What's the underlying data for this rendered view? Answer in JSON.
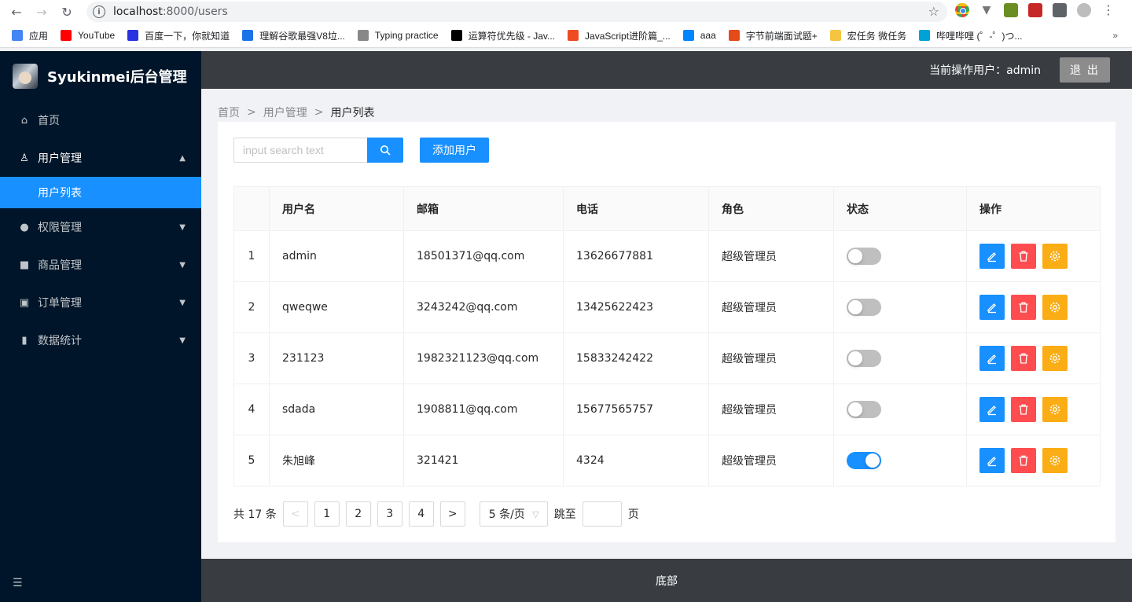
{
  "browser": {
    "url_host": "localhost",
    "url_rest": ":8000/users",
    "bookmarks": [
      {
        "label": "应用",
        "color": "#4285f4"
      },
      {
        "label": "YouTube",
        "color": "#ff0000"
      },
      {
        "label": "百度一下，你就知道",
        "color": "#2932e1"
      },
      {
        "label": "理解谷歌最强V8垃...",
        "color": "#1a73e8"
      },
      {
        "label": "Typing practice",
        "color": "#888888"
      },
      {
        "label": "运算符优先级 - Jav...",
        "color": "#000000"
      },
      {
        "label": "JavaScript进阶篇_...",
        "color": "#f04a23"
      },
      {
        "label": "aaa",
        "color": "#0084ff"
      },
      {
        "label": "字节前端面试题+",
        "color": "#e64a19"
      },
      {
        "label": "宏任务 微任务",
        "color": "#f5c542"
      },
      {
        "label": "哔哩哔哩 (゜-゜)つ...",
        "color": "#00a1d6"
      }
    ],
    "more": "»"
  },
  "sidebar": {
    "logo_text": "Syukinmei后台管理",
    "menu": [
      {
        "label": "首页",
        "icon": "home-icon",
        "glyph": "⌂",
        "arrow": ""
      },
      {
        "label": "用户管理",
        "icon": "user-icon",
        "glyph": "♙",
        "arrow": "▲"
      },
      {
        "label": "权限管理",
        "icon": "bulb-icon",
        "glyph": "●",
        "arrow": "▼"
      },
      {
        "label": "商品管理",
        "icon": "shopping-bag-icon",
        "glyph": "■",
        "arrow": "▼"
      },
      {
        "label": "订单管理",
        "icon": "order-icon",
        "glyph": "▣",
        "arrow": "▼"
      },
      {
        "label": "数据统计",
        "icon": "bar-chart-icon",
        "glyph": "▮",
        "arrow": "▼"
      }
    ],
    "submenu_active": "用户列表",
    "trigger": "☰"
  },
  "header": {
    "current_user": "当前操作用户：admin",
    "logout_label": "退 出"
  },
  "breadcrumb": {
    "items": [
      "首页",
      "用户管理",
      "用户列表"
    ],
    "separator": ">"
  },
  "toolbar": {
    "search_placeholder": "input search text",
    "add_label": "添加用户"
  },
  "table": {
    "headers": [
      "",
      "用户名",
      "邮箱",
      "电话",
      "角色",
      "状态",
      "操作"
    ],
    "rows": [
      {
        "idx": "1",
        "username": "admin",
        "email": "18501371@qq.com",
        "phone": "13626677881",
        "role": "超级管理员",
        "status": false
      },
      {
        "idx": "2",
        "username": "qweqwe",
        "email": "3243242@qq.com",
        "phone": "13425622423",
        "role": "超级管理员",
        "status": false
      },
      {
        "idx": "3",
        "username": "231123",
        "email": "1982321123@qq.com",
        "phone": "15833242422",
        "role": "超级管理员",
        "status": false
      },
      {
        "idx": "4",
        "username": "sdada",
        "email": "1908811@qq.com",
        "phone": "15677565757",
        "role": "超级管理员",
        "status": false
      },
      {
        "idx": "5",
        "username": "朱旭峰",
        "email": "321421",
        "phone": "4324",
        "role": "超级管理员",
        "status": true
      }
    ]
  },
  "pagination": {
    "total": "共 17 条",
    "pages": [
      "1",
      "2",
      "3",
      "4"
    ],
    "prev": "<",
    "next": ">",
    "page_size": "5 条/页",
    "jump_label": "跳至",
    "page_unit": "页"
  },
  "footer": {
    "text": "底部"
  },
  "colors": {
    "primary": "#1890ff",
    "danger": "#ff4d4f",
    "warning": "#faad14",
    "sidebar_bg": "#001529",
    "header_bg": "#393d42"
  }
}
